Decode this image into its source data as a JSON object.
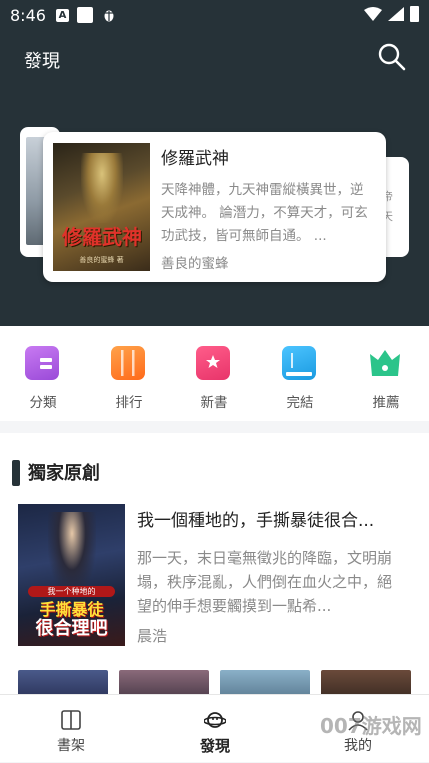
{
  "status_bar": {
    "time": "8:46",
    "a_icon": "A"
  },
  "header": {
    "title": "發現"
  },
  "featured": {
    "title": "修羅武神",
    "description": "天降神體，九天神雷縱橫異世，逆天成神。 論潛力，不算天才，可玄功武技，皆可無師自通。 ...",
    "author": "善良的蜜蜂",
    "cover_title": "修羅武神",
    "cover_author": "善良的蜜蜂 著",
    "right_peek": "帝\n天"
  },
  "categories": [
    {
      "label": "分類",
      "color": "#b35ee8",
      "icon": "category-icon"
    },
    {
      "label": "排行",
      "color": "#ff8a2b",
      "icon": "ranking-icon"
    },
    {
      "label": "新書",
      "color": "#f0457a",
      "icon": "bookmark-star-icon"
    },
    {
      "label": "完結",
      "color": "#2bb3f2",
      "icon": "finished-book-icon"
    },
    {
      "label": "推薦",
      "color": "#2bc48a",
      "icon": "crown-icon"
    }
  ],
  "exclusive": {
    "section_title": "獨家原創",
    "book": {
      "title": "我一個種地的，手撕暴徒很合...",
      "description": "那一天，末日毫無徵兆的降臨，文明崩塌，秩序混亂，人們倒在血火之中，絕望的伸手想要觸摸到一點希...",
      "author": "晨浩",
      "cover_line_small": "我一个种地的",
      "cover_line1": "手撕暴徒",
      "cover_line2": "很合理吧"
    }
  },
  "tabbar": [
    {
      "label": "書架",
      "icon": "bookshelf-icon"
    },
    {
      "label": "發現",
      "icon": "discover-planet-icon"
    },
    {
      "label": "我的",
      "icon": "profile-icon"
    }
  ],
  "watermark": "007游戏网"
}
